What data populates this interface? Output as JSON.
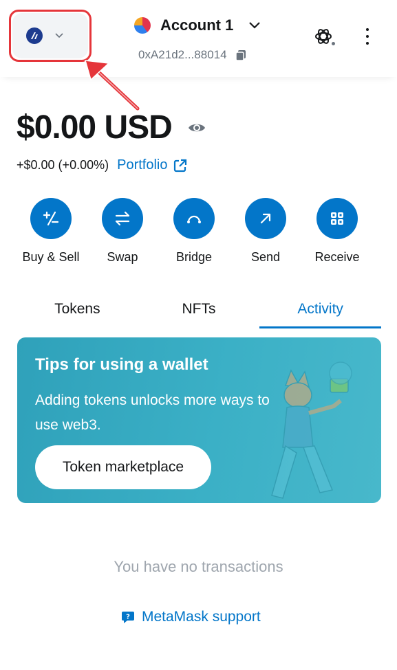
{
  "header": {
    "network": {
      "logo_icon": "network-logo-icon",
      "chevron_icon": "chevron-down-icon"
    },
    "account": {
      "name": "Account 1",
      "address": "0xA21d2...88014",
      "avatar_icon": "account-avatar-icon",
      "chevron_icon": "chevron-down-icon",
      "copy_icon": "copy-icon"
    },
    "snaps_icon": "openai-snaps-icon",
    "more_icon": "more-vertical-icon"
  },
  "balance": {
    "amount": "$0.00",
    "currency": "USD",
    "eye_icon": "eye-icon",
    "change": "+$0.00 (+0.00%)",
    "portfolio_label": "Portfolio",
    "portfolio_icon": "external-link-icon"
  },
  "actions": [
    {
      "label": "Buy & Sell",
      "icon": "plus-minus-icon"
    },
    {
      "label": "Swap",
      "icon": "swap-arrows-icon"
    },
    {
      "label": "Bridge",
      "icon": "bridge-icon"
    },
    {
      "label": "Send",
      "icon": "arrow-up-right-icon"
    },
    {
      "label": "Receive",
      "icon": "qr-code-icon"
    }
  ],
  "tabs": [
    {
      "label": "Tokens",
      "active": false
    },
    {
      "label": "NFTs",
      "active": false
    },
    {
      "label": "Activity",
      "active": true
    }
  ],
  "tips_card": {
    "title": "Tips for using a wallet",
    "body": "Adding tokens unlocks more ways to use web3.",
    "button_label": "Token marketplace"
  },
  "activity": {
    "empty_text": "You have no transactions",
    "support_label": "MetaMask support",
    "support_icon": "message-question-icon"
  },
  "colors": {
    "accent": "#0376c9",
    "text": "#141618",
    "muted": "#6a737d",
    "highlight_red": "#e5353a",
    "card_bg": "#3bb0c6"
  }
}
